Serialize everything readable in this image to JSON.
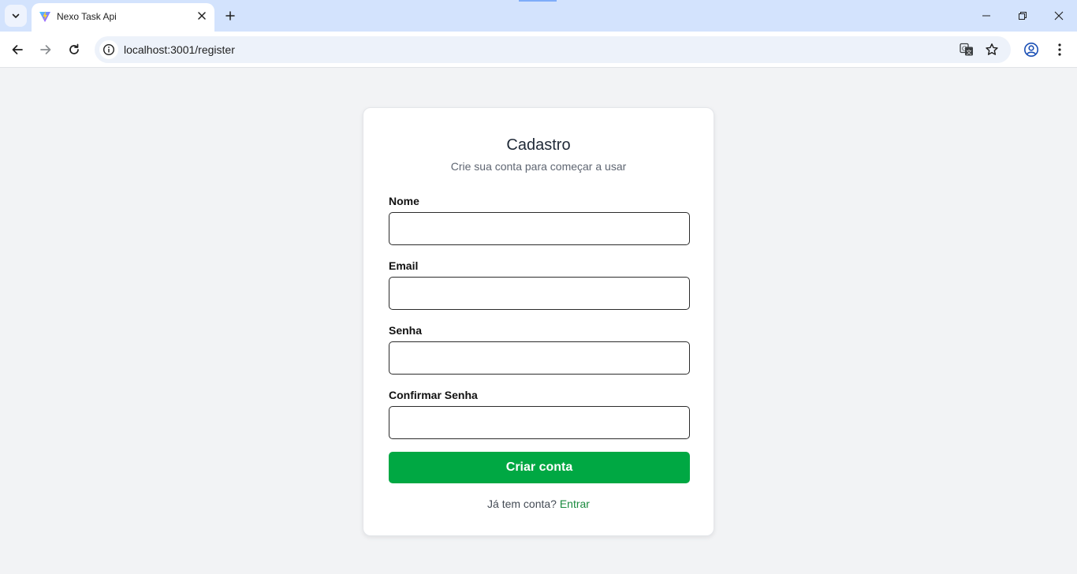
{
  "browser": {
    "tab_title": "Nexo Task Api",
    "url": "localhost:3001/register",
    "accent_color": "#d3e3fd"
  },
  "icons": {
    "tab_search": "chevron-down-icon",
    "favicon": "vite-logo-icon",
    "tab_close": "close-icon",
    "new_tab": "plus-icon",
    "back": "arrow-left-icon",
    "forward": "arrow-right-icon",
    "reload": "reload-icon",
    "site_info": "info-icon",
    "translate": "translate-icon",
    "bookmark": "star-icon",
    "profile": "account-icon",
    "menu": "more-vert-icon",
    "minimize": "minimize-icon",
    "restore": "restore-icon",
    "close_window": "close-icon"
  },
  "page": {
    "title": "Cadastro",
    "subtitle": "Crie sua conta para começar a usar",
    "fields": [
      {
        "label": "Nome",
        "value": "",
        "placeholder": ""
      },
      {
        "label": "Email",
        "value": "",
        "placeholder": ""
      },
      {
        "label": "Senha",
        "value": "",
        "placeholder": ""
      },
      {
        "label": "Confirmar Senha",
        "value": "",
        "placeholder": ""
      }
    ],
    "submit_label": "Criar conta",
    "login_prompt": "Já tem conta?",
    "login_link": "Entrar",
    "colors": {
      "primary": "#00a843",
      "link": "#1a8a3e",
      "background": "#f2f3f5"
    }
  }
}
